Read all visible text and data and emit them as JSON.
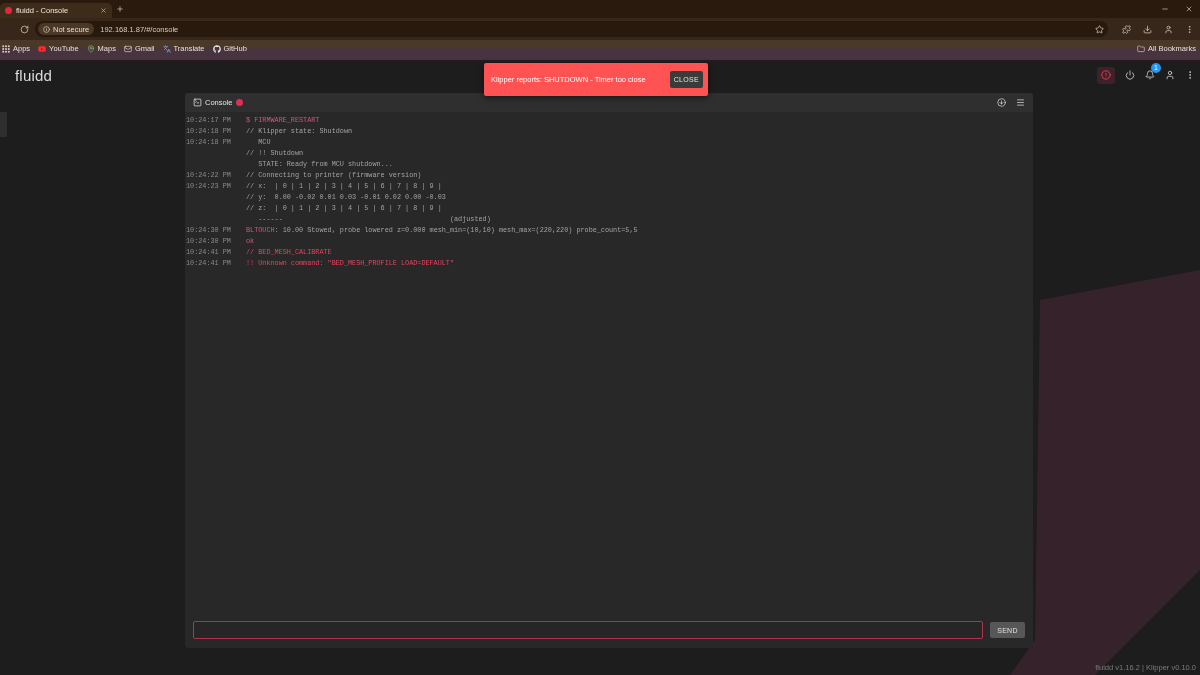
{
  "browser": {
    "tabs": [
      {
        "title": "fluidd - Console",
        "selected": true
      }
    ],
    "address_bar": {
      "security_chip": "Not secure",
      "url": "192.168.1.87/#/console"
    },
    "bookmarks": [
      {
        "kind": "apps",
        "label": "Apps"
      },
      {
        "kind": "video",
        "label": "YouTube"
      },
      {
        "kind": "map",
        "label": "Maps"
      },
      {
        "kind": "mail",
        "label": "Gmail"
      },
      {
        "kind": "translate",
        "label": "Translate"
      },
      {
        "kind": "code",
        "label": "GitHub"
      }
    ],
    "all_bookmarks": "All Bookmarks"
  },
  "header": {
    "logo": "fluidd",
    "notification_count": "1"
  },
  "snackbar": {
    "message": "Klipper reports: SHUTDOWN - Timer too close",
    "action": "CLOSE"
  },
  "console": {
    "title": "Console",
    "entries": [
      {
        "time": "10:24:17 PM",
        "kind": "command",
        "lines": [
          "$ FIRMWARE_RESTART"
        ]
      },
      {
        "time": "10:24:18 PM",
        "kind": "response",
        "lines": [
          "// Klipper state: Shutdown"
        ]
      },
      {
        "time": "10:24:18 PM",
        "kind": "response",
        "lines": [
          "   MCU",
          "// !! Shutdown",
          "   STATE: Ready from MCU shutdown..."
        ]
      },
      {
        "time": "10:24:22 PM",
        "kind": "response",
        "lines": [
          "// Connecting to printer (firmware version)"
        ]
      },
      {
        "time": "10:24:23 PM",
        "kind": "response",
        "lines": [
          "// x:  | 0 | 1 | 2 | 3 | 4 | 5 | 6 | 7 | 8 | 9 |",
          "// y:  0.00 -0.02 0.01 0.03 -0.01 0.02 0.00 -0.03",
          "// z:  | 0 | 1 | 2 | 3 | 4 | 5 | 6 | 7 | 8 | 9 |",
          "   ------                                         (adjusted)"
        ]
      },
      {
        "time": "10:24:30 PM",
        "kind": "tagged",
        "tag": "BLTOUCH",
        "lines": [
          ": 10.00 Stowed, probe lowered z=0.000 mesh_min=(10,10) mesh_max=(220,220) probe_count=5,5"
        ]
      },
      {
        "time": "10:24:30 PM",
        "kind": "command",
        "lines": [
          "ok"
        ]
      },
      {
        "time": "10:24:41 PM",
        "kind": "error",
        "lines": [
          "// BED_MESH_CALIBRATE"
        ]
      },
      {
        "time": "10:24:41 PM",
        "kind": "error",
        "lines": [
          "!! Unknown command: \"BED_MESH_PROFILE LOAD=DEFAULT\""
        ]
      }
    ],
    "command_input": {
      "focused": true
    },
    "send_button": "SEND"
  },
  "footer": {
    "version": "fluidd v1.16.2 | Klipper v0.10.0"
  }
}
